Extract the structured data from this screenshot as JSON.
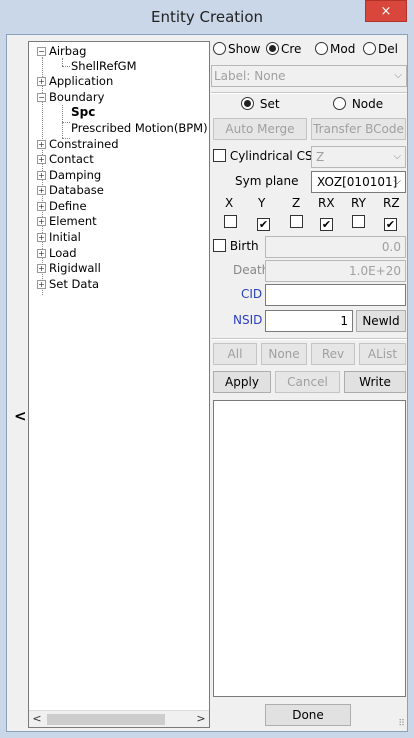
{
  "window": {
    "title": "Entity Creation",
    "close_glyph": "×"
  },
  "collapse_glyph": "<",
  "tree": {
    "items": [
      {
        "label": "Airbag",
        "toggle": "−"
      },
      {
        "label": "ShellRefGM",
        "toggle": ""
      },
      {
        "label": "Application",
        "toggle": "+"
      },
      {
        "label": "Boundary",
        "toggle": "−"
      },
      {
        "label": "Spc",
        "toggle": ""
      },
      {
        "label": "Prescribed Motion(BPM)",
        "toggle": ""
      },
      {
        "label": "Constrained",
        "toggle": "+"
      },
      {
        "label": "Contact",
        "toggle": "+"
      },
      {
        "label": "Damping",
        "toggle": "+"
      },
      {
        "label": "Database",
        "toggle": "+"
      },
      {
        "label": "Define",
        "toggle": "+"
      },
      {
        "label": "Element",
        "toggle": "+"
      },
      {
        "label": "Initial",
        "toggle": "+"
      },
      {
        "label": "Load",
        "toggle": "+"
      },
      {
        "label": "Rigidwall",
        "toggle": "+"
      },
      {
        "label": "Set Data",
        "toggle": "+"
      }
    ],
    "scroll_left": "<",
    "scroll_right": ">"
  },
  "mode": {
    "options": [
      "Show",
      "Cre",
      "Mod",
      "Del"
    ],
    "selected": "Cre"
  },
  "label_field": {
    "label": "Label:",
    "value": "None",
    "arrow": "⌵"
  },
  "set_node": {
    "options": [
      "Set",
      "Node"
    ],
    "selected": "Set"
  },
  "buttons": {
    "auto_merge": "Auto Merge",
    "transfer_bcode": "Transfer BCode",
    "new_id": "NewId",
    "all": "All",
    "none": "None",
    "rev": "Rev",
    "alist": "AList",
    "apply": "Apply",
    "cancel": "Cancel",
    "write": "Write",
    "done": "Done"
  },
  "cylindrical": {
    "label": "Cylindrical CS",
    "checked": false,
    "value": "Z",
    "arrow": "⌵"
  },
  "sym_plane": {
    "label": "Sym plane",
    "value": "XOZ[010101]",
    "arrow": "⌵"
  },
  "dofs": [
    {
      "label": "X",
      "checked": false,
      "mark": ""
    },
    {
      "label": "Y",
      "checked": true,
      "mark": "✔"
    },
    {
      "label": "Z",
      "checked": false,
      "mark": ""
    },
    {
      "label": "RX",
      "checked": true,
      "mark": "✔"
    },
    {
      "label": "RY",
      "checked": false,
      "mark": ""
    },
    {
      "label": "RZ",
      "checked": true,
      "mark": "✔"
    }
  ],
  "birth": {
    "label": "Birth",
    "checked": false,
    "value": "0.0"
  },
  "death": {
    "label": "Death",
    "value": "1.0E+20"
  },
  "cid": {
    "label": "CID",
    "value": ""
  },
  "nsid": {
    "label": "NSID",
    "value": "1"
  },
  "grip": "⠿"
}
